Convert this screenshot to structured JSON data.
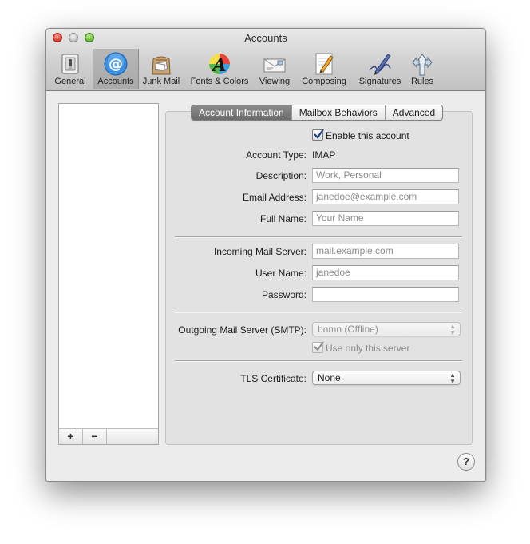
{
  "window": {
    "title": "Accounts"
  },
  "toolbar": {
    "items": [
      {
        "label": "General",
        "icon": "general-switch-icon"
      },
      {
        "label": "Accounts",
        "icon": "at-sign-icon"
      },
      {
        "label": "Junk Mail",
        "icon": "junk-mail-bag-icon"
      },
      {
        "label": "Fonts & Colors",
        "icon": "fonts-colors-icon"
      },
      {
        "label": "Viewing",
        "icon": "viewing-envelope-icon"
      },
      {
        "label": "Composing",
        "icon": "composing-pencil-icon"
      },
      {
        "label": "Signatures",
        "icon": "signature-pen-icon"
      },
      {
        "label": "Rules",
        "icon": "rules-arrows-icon"
      }
    ],
    "selected": "Accounts"
  },
  "list_bar": {
    "add_label": "+",
    "remove_label": "−"
  },
  "tabs": {
    "account_info": "Account Information",
    "mailbox_behaviors": "Mailbox Behaviors",
    "advanced": "Advanced"
  },
  "form": {
    "enable_label": "Enable this account",
    "enable_checked": true,
    "account_type_label": "Account Type:",
    "account_type_value": "IMAP",
    "description_label": "Description:",
    "description_placeholder": "Work, Personal",
    "email_label": "Email Address:",
    "email_placeholder": "janedoe@example.com",
    "fullname_label": "Full Name:",
    "fullname_placeholder": "Your Name",
    "incoming_label": "Incoming Mail Server:",
    "incoming_placeholder": "mail.example.com",
    "username_label": "User Name:",
    "username_placeholder": "janedoe",
    "password_label": "Password:",
    "password_value": "",
    "smtp_label": "Outgoing Mail Server (SMTP):",
    "smtp_value": "bnmn (Offline)",
    "use_only_label": "Use only this server",
    "use_only_checked": true,
    "tls_label": "TLS Certificate:",
    "tls_value": "None"
  },
  "help": {
    "label": "?"
  }
}
